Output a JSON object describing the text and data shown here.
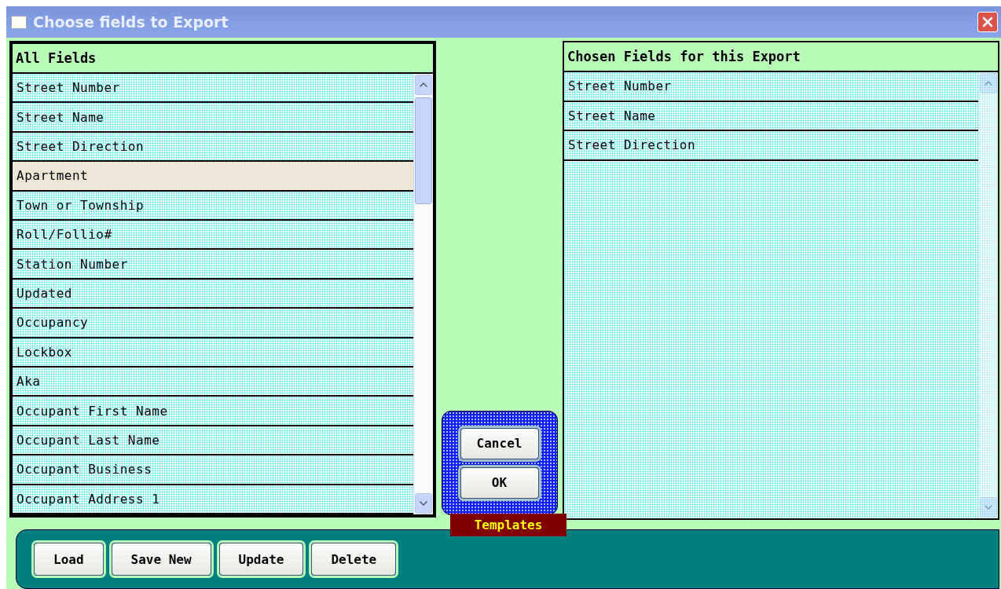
{
  "window": {
    "title": "Choose fields to Export"
  },
  "all_fields": {
    "title": "All Fields",
    "items": [
      {
        "label": "Street Number",
        "selected": false
      },
      {
        "label": "Street Name",
        "selected": false
      },
      {
        "label": "Street Direction",
        "selected": false
      },
      {
        "label": "Apartment",
        "selected": true
      },
      {
        "label": "Town or Township",
        "selected": false
      },
      {
        "label": "Roll/Follio#",
        "selected": false
      },
      {
        "label": "Station Number",
        "selected": false
      },
      {
        "label": "Updated",
        "selected": false
      },
      {
        "label": "Occupancy",
        "selected": false
      },
      {
        "label": "Lockbox",
        "selected": false
      },
      {
        "label": "Aka",
        "selected": false
      },
      {
        "label": "Occupant First Name",
        "selected": false
      },
      {
        "label": "Occupant Last Name",
        "selected": false
      },
      {
        "label": "Occupant Business",
        "selected": false
      },
      {
        "label": "Occupant Address 1",
        "selected": false
      }
    ]
  },
  "chosen_fields": {
    "title": "Chosen Fields for this Export",
    "items": [
      {
        "label": "Street Number",
        "selected": false
      },
      {
        "label": "Street Name",
        "selected": false
      },
      {
        "label": "Street Direction",
        "selected": false
      }
    ]
  },
  "dialog_buttons": [
    "Cancel",
    "OK"
  ],
  "templates": {
    "title": "Templates",
    "buttons": [
      "Load",
      "Save New",
      "Update",
      "Delete"
    ]
  }
}
